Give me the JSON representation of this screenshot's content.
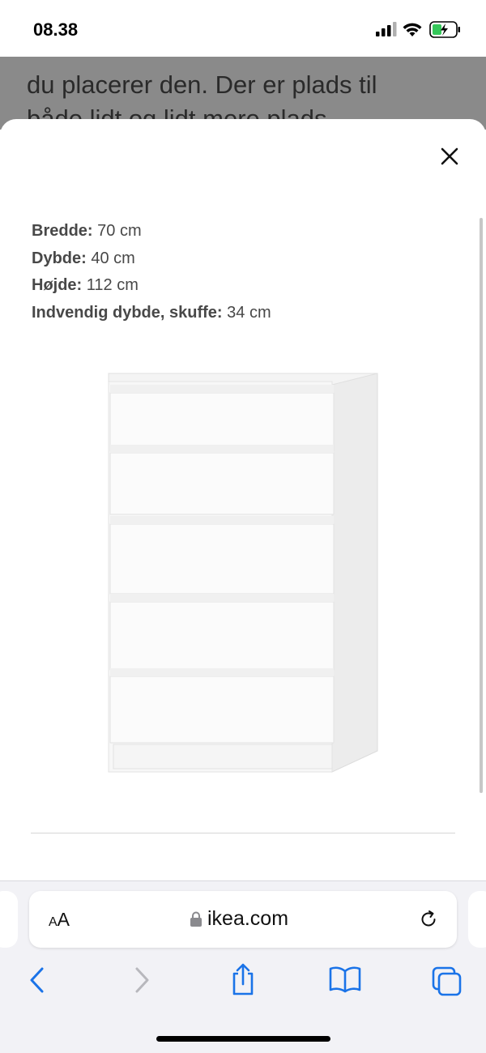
{
  "status_bar": {
    "time": "08.38"
  },
  "background_page": {
    "line1": "du placerer den. Der er plads til",
    "line2": "både lidt og lidt mere plads"
  },
  "modal": {
    "close_icon": "close-icon",
    "specs": [
      {
        "label": "Bredde:",
        "value": " 70 cm"
      },
      {
        "label": "Dybde:",
        "value": " 40 cm"
      },
      {
        "label": "Højde:",
        "value": " 112 cm"
      },
      {
        "label": "Indvendig dybde, skuffe:",
        "value": " 34 cm"
      }
    ],
    "product_image": {
      "drawers": 5,
      "color": "#ffffff"
    }
  },
  "browser": {
    "aa_label_big": "A",
    "aa_label_small": "A",
    "aa_small_first": "A",
    "url": "ikea.com",
    "lock_icon": "lock-icon",
    "reload_icon": "reload-icon",
    "toolbar": [
      "back-icon",
      "forward-icon",
      "share-icon",
      "bookmarks-icon",
      "tabs-icon"
    ],
    "accent_color": "#1a73e8"
  }
}
